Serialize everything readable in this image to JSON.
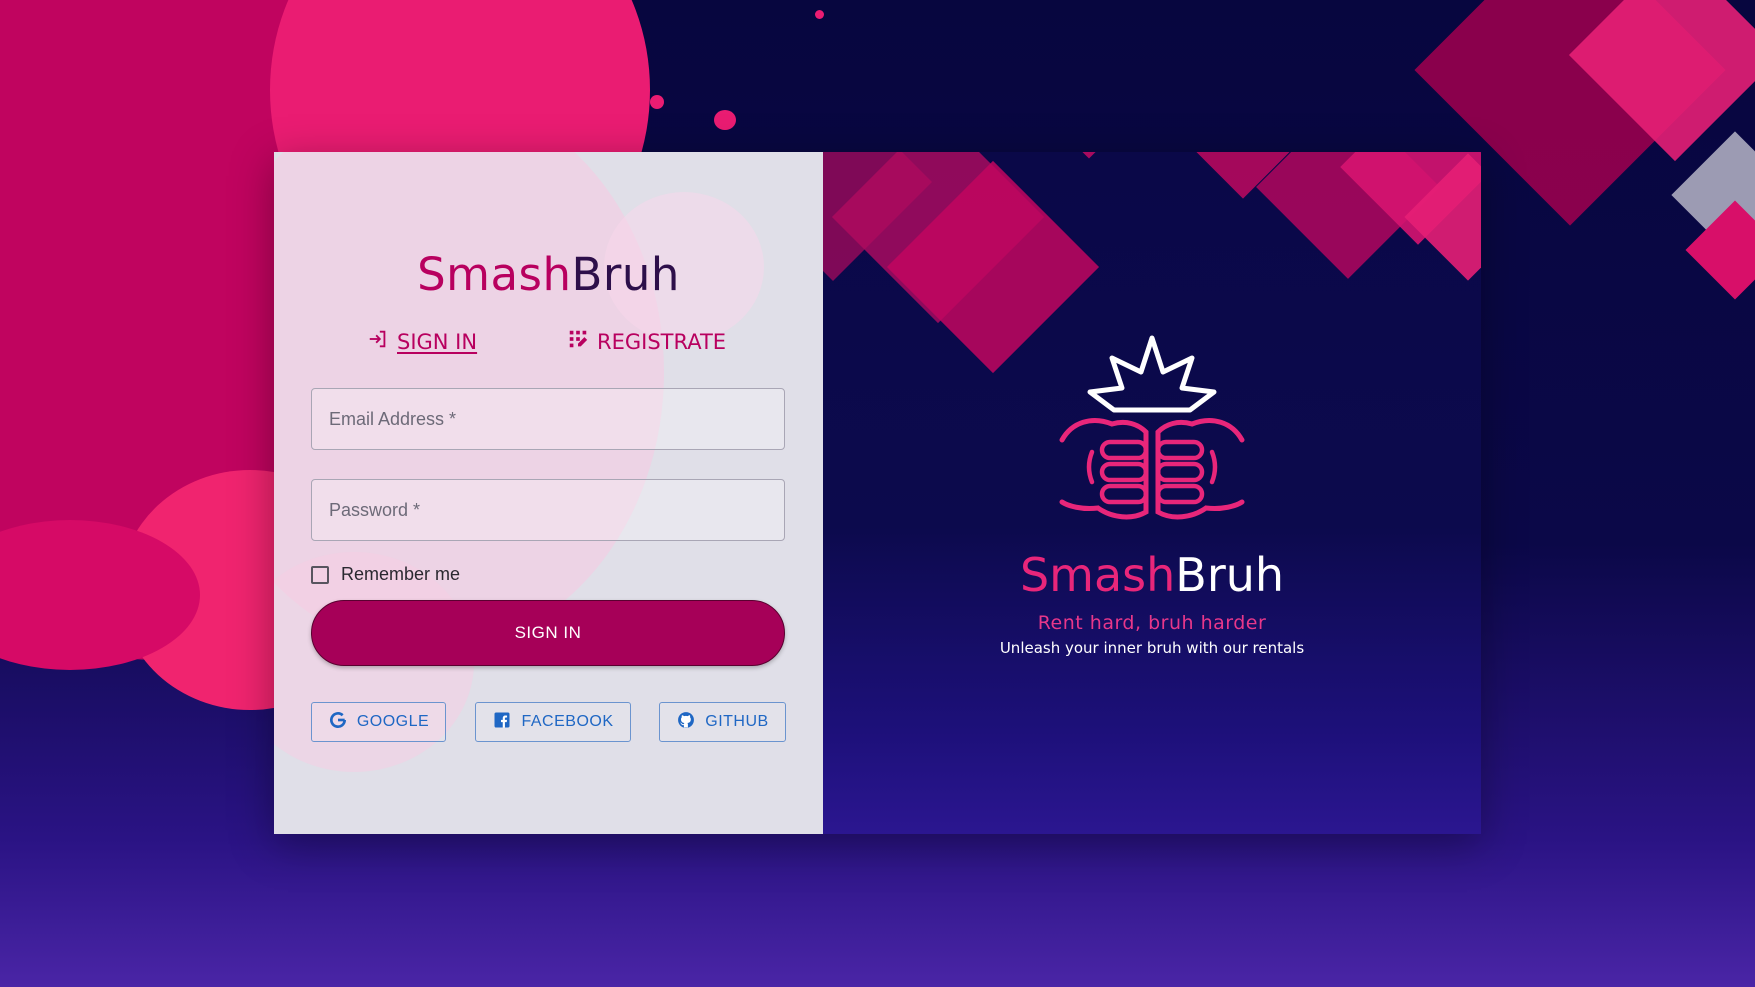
{
  "brand": {
    "name_part1": "Smash",
    "name_part2": "Bruh"
  },
  "tabs": [
    {
      "label": "SIGN IN",
      "icon": "login-icon",
      "active": true
    },
    {
      "label": "REGISTRATE",
      "icon": "app-registration-icon",
      "active": false
    }
  ],
  "form": {
    "email": {
      "placeholder": "Email Address *",
      "value": ""
    },
    "password": {
      "placeholder": "Password *",
      "value": ""
    },
    "remember_label": "Remember me",
    "remember_checked": false,
    "submit_label": "SIGN IN"
  },
  "social": [
    {
      "label": "GOOGLE",
      "icon": "google-icon"
    },
    {
      "label": "FACEBOOK",
      "icon": "facebook-icon"
    },
    {
      "label": "GITHUB",
      "icon": "github-icon"
    }
  ],
  "hero": {
    "logo_icon": "fist-bump-burst-icon",
    "title_part1": "Smash",
    "title_part2": "Bruh",
    "slogan": "Rent hard, bruh harder",
    "tagline": "Unleash your inner bruh with our rentals"
  },
  "colors": {
    "brand_magenta": "#b8005f",
    "button_magenta": "#a60058",
    "hero_pink": "#e8267a",
    "background_navy": "#07063f",
    "social_blue": "#1f67c4"
  }
}
